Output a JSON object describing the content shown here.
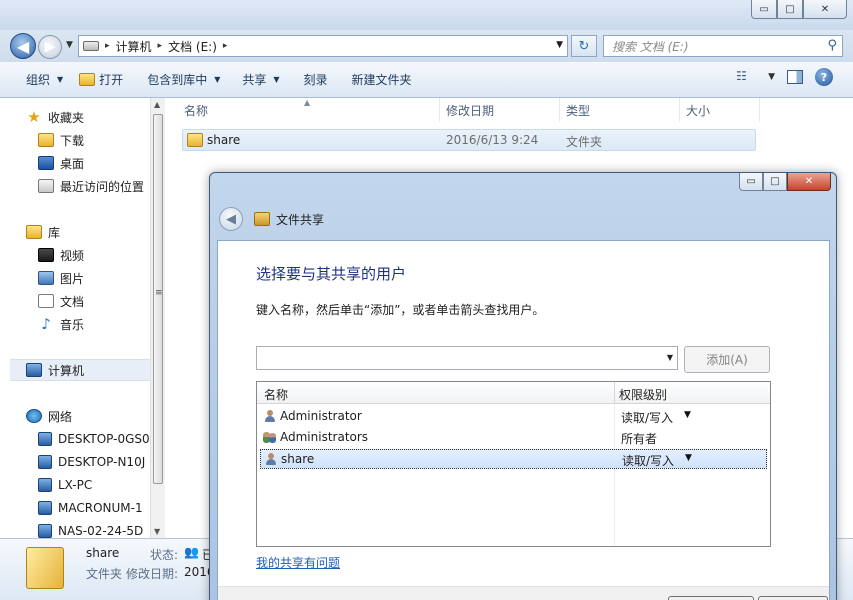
{
  "explorer": {
    "caption": {
      "minimize": "▭",
      "maximize": "□",
      "close": "✕"
    },
    "address": {
      "parts": [
        "计算机",
        "文档 (E:)"
      ],
      "sep": "▸"
    },
    "search": {
      "placeholder": "搜索 文档 (E:)"
    },
    "toolbar": {
      "organize": "组织",
      "open": "打开",
      "include_in_library": "包含到库中",
      "share": "共享",
      "burn": "刻录",
      "new_folder": "新建文件夹"
    },
    "nav": {
      "favorites": "收藏夹",
      "downloads": "下载",
      "desktop": "桌面",
      "recent": "最近访问的位置",
      "libraries": "库",
      "videos": "视频",
      "pictures": "图片",
      "documents": "文档",
      "music": "音乐",
      "computer": "计算机",
      "network": "网络",
      "hosts": [
        "DESKTOP-0GS0",
        "DESKTOP-N10J",
        "LX-PC",
        "MACRONUM-1",
        "NAS-02-24-5D"
      ]
    },
    "columns": {
      "name": "名称",
      "modified": "修改日期",
      "type": "类型",
      "size": "大小"
    },
    "files": [
      {
        "name": "share",
        "modified": "2016/6/13 9:24",
        "type": "文件夹"
      }
    ],
    "details": {
      "name": "share",
      "type": "文件夹",
      "state_label": "状态:",
      "state_value": "已",
      "modified_label": "修改日期:",
      "modified_value": "2016"
    }
  },
  "dialog": {
    "title": "文件共享",
    "heading": "选择要与其共享的用户",
    "instruction": "键入名称，然后单击“添加”，或者单击箭头查找用户。",
    "add_button": "添加(A)",
    "columns": {
      "name": "名称",
      "permission": "权限级别"
    },
    "users": [
      {
        "name": "Administrator",
        "permission": "读取/写入",
        "kind": "user",
        "has_dropdown": true
      },
      {
        "name": "Administrators",
        "permission": "所有者",
        "kind": "group",
        "has_dropdown": false
      },
      {
        "name": "share",
        "permission": "读取/写入",
        "kind": "user",
        "has_dropdown": true
      }
    ],
    "trouble_link": "我的共享有问题"
  }
}
